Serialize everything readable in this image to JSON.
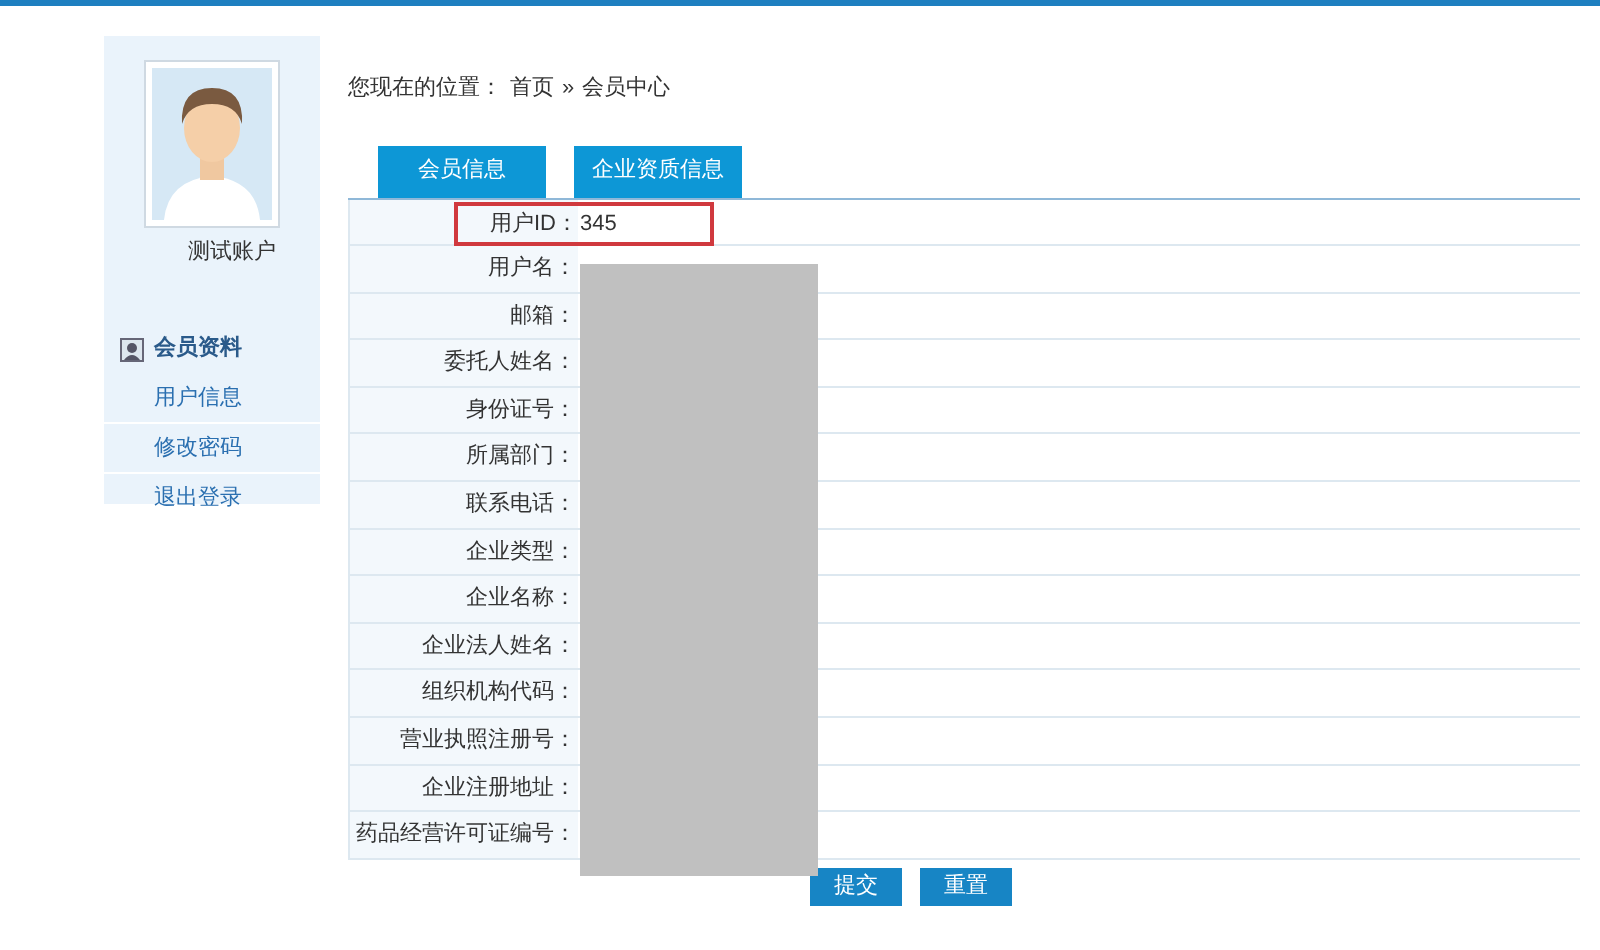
{
  "sidebar": {
    "account_name": "测试账户",
    "section_title": "会员资料",
    "items": [
      {
        "label": "用户信息"
      },
      {
        "label": "修改密码"
      },
      {
        "label": "退出登录"
      }
    ]
  },
  "breadcrumb": {
    "prefix": "您现在的位置：",
    "links": [
      "首页",
      "会员中心"
    ],
    "separator": "»"
  },
  "tabs": [
    {
      "label": "会员信息"
    },
    {
      "label": "企业资质信息"
    }
  ],
  "form": {
    "rows": [
      {
        "label": "用户ID：",
        "value": "345",
        "highlighted": true
      },
      {
        "label": "用户名：",
        "value": "",
        "highlighted": false
      },
      {
        "label": "邮箱：",
        "value": "",
        "highlighted": false
      },
      {
        "label": "委托人姓名：",
        "value": "",
        "highlighted": false
      },
      {
        "label": "身份证号：",
        "value": "",
        "highlighted": false
      },
      {
        "label": "所属部门：",
        "value": "",
        "highlighted": false
      },
      {
        "label": "联系电话：",
        "value": "",
        "highlighted": false
      },
      {
        "label": "企业类型：",
        "value": "",
        "highlighted": false
      },
      {
        "label": "企业名称：",
        "value": "",
        "highlighted": false
      },
      {
        "label": "企业法人姓名：",
        "value": "",
        "highlighted": false
      },
      {
        "label": "组织机构代码：",
        "value": "",
        "highlighted": false
      },
      {
        "label": "营业执照注册号：",
        "value": "",
        "highlighted": false
      },
      {
        "label": "企业注册地址：",
        "value": "",
        "highlighted": false
      },
      {
        "label": "药品经营许可证编号：",
        "value": "",
        "highlighted": false
      }
    ],
    "buttons": [
      "提交",
      "重置"
    ]
  }
}
